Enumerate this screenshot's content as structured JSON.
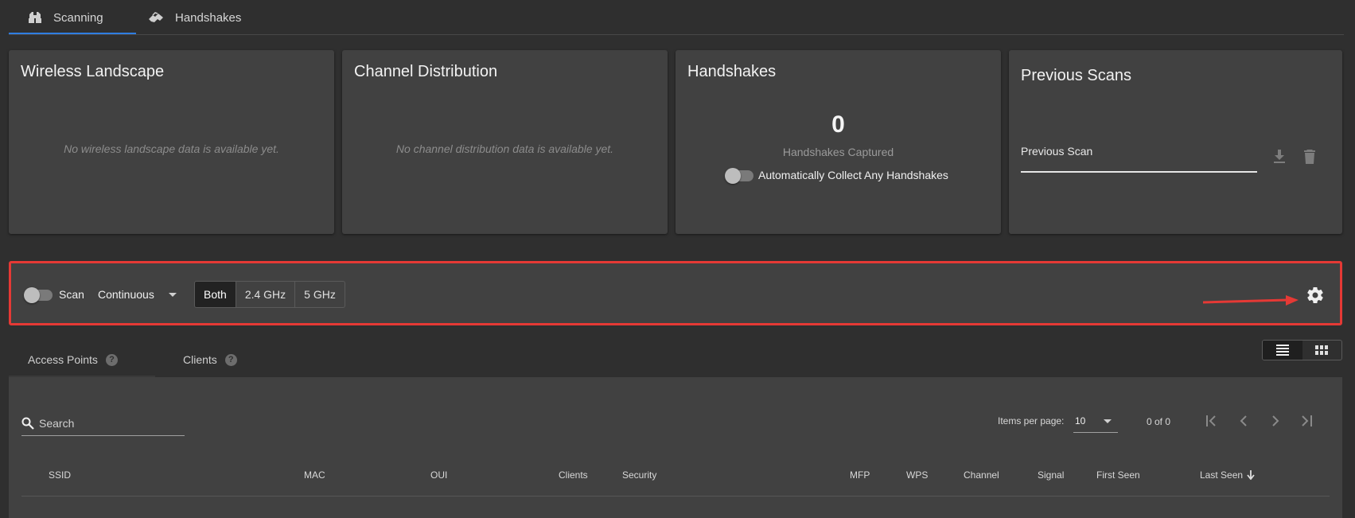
{
  "top_tabs": [
    {
      "label": "Scanning",
      "icon": "binoculars-icon",
      "active": true
    },
    {
      "label": "Handshakes",
      "icon": "handshake-icon",
      "active": false
    }
  ],
  "cards": {
    "wireless_landscape": {
      "title": "Wireless Landscape",
      "empty": "No wireless landscape data is available yet."
    },
    "channel_distribution": {
      "title": "Channel Distribution",
      "empty": "No channel distribution data is available yet."
    },
    "handshakes": {
      "title": "Handshakes",
      "count": "0",
      "count_label": "Handshakes Captured",
      "auto_collect_label": "Automatically Collect Any Handshakes",
      "auto_collect_on": false
    },
    "previous_scans": {
      "title": "Previous Scans",
      "select_value": "Previous Scan"
    }
  },
  "scan_controls": {
    "scan_label": "Scan",
    "scan_on": false,
    "mode": "Continuous",
    "bands": [
      "Both",
      "2.4 GHz",
      "5 GHz"
    ],
    "active_band": "Both",
    "highlight_color": "#e53935"
  },
  "sub_tabs": [
    {
      "label": "Access Points",
      "active": true
    },
    {
      "label": "Clients",
      "active": false
    }
  ],
  "table": {
    "search_placeholder": "Search",
    "items_per_page_label": "Items per page:",
    "items_per_page": "10",
    "range": "0 of 0",
    "columns": [
      "SSID",
      "MAC",
      "OUI",
      "Clients",
      "Security",
      "MFP",
      "WPS",
      "Channel",
      "Signal",
      "First Seen",
      "Last Seen"
    ],
    "sort_column": "Last Seen",
    "sort_direction": "descending",
    "rows": []
  },
  "accent_color": "#2f7de1"
}
